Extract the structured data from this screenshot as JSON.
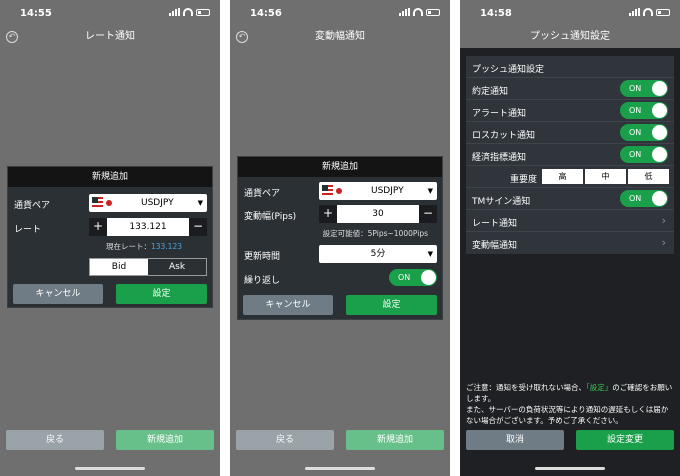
{
  "screen1": {
    "time": "14:55",
    "nav_title": "レート通知",
    "dialog_title": "新規追加",
    "pair_label": "通貨ペア",
    "pair_value": "USDJPY",
    "rate_label": "レート",
    "rate_value": "133.121",
    "current_rate_label": "現在レート：",
    "current_rate_value": "133.123",
    "bid": "Bid",
    "ask": "Ask",
    "cancel": "キャンセル",
    "confirm": "設定",
    "footer_back": "戻る",
    "footer_add": "新規追加"
  },
  "screen2": {
    "time": "14:56",
    "nav_title": "変動幅通知",
    "dialog_title": "新規追加",
    "pair_label": "通貨ペア",
    "pair_value": "USDJPY",
    "range_label": "変動幅(Pips)",
    "range_value": "30",
    "range_hint": "設定可能値：5Pips~1000Pips",
    "interval_label": "更新時間",
    "interval_value": "5分",
    "repeat_label": "繰り返し",
    "repeat_toggle": "ON",
    "cancel": "キャンセル",
    "confirm": "設定",
    "footer_back": "戻る",
    "footer_add": "新規追加"
  },
  "screen3": {
    "time": "14:58",
    "nav_title": "プッシュ通知設定",
    "section_title": "プッシュ通知設定",
    "items": [
      {
        "label": "約定通知",
        "toggle": "ON"
      },
      {
        "label": "アラート通知",
        "toggle": "ON"
      },
      {
        "label": "ロスカット通知",
        "toggle": "ON"
      },
      {
        "label": "経済指標通知",
        "toggle": "ON"
      }
    ],
    "priority_label": "重要度",
    "priority_options": [
      "高",
      "中",
      "低"
    ],
    "tm_label": "TMサイン通知",
    "tm_toggle": "ON",
    "rate_link": "レート通知",
    "range_link": "変動幅通知",
    "note_prefix": "ご注意：通知を受け取れない場合、",
    "note_highlight": "「設定」",
    "note_suffix": "のご確認をお願いします。",
    "note_line2": "また、サーバーの負荷状況等により通知の遅延もしくは届かない場合がございます。予めご了承ください。",
    "cancel": "取消",
    "save": "設定変更"
  },
  "colors": {
    "accent_green": "#1aa04a",
    "link_blue": "#4aa3e0",
    "highlight_green": "#3ec35c"
  }
}
